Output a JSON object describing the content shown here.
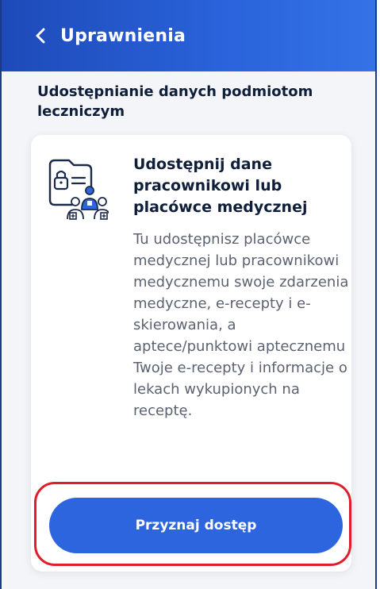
{
  "header": {
    "title": "Uprawnienia",
    "back_icon": "chevron-left-icon"
  },
  "section": {
    "title": "Udostępnianie danych podmiotom leczniczym"
  },
  "card": {
    "icon": "medical-folder-share-icon",
    "title": "Udostępnij dane pracownikowi lub placówce medycznej",
    "description": "Tu udostępnisz placówce medycznej lub pracownikowi medycznemu swoje zdarzenia medyczne, e-recepty i e-skierowania, a aptece/punktowi aptecznemu Twoje e-recepty i informacje o lekach wykupionych na receptę.",
    "button_label": "Przyznaj dostęp"
  },
  "colors": {
    "header_start": "#1e4ab8",
    "header_end": "#3572e6",
    "primary": "#2c65de",
    "highlight": "#e01d2b",
    "text_dark": "#0f1f3a",
    "text_muted": "#5b6270"
  }
}
